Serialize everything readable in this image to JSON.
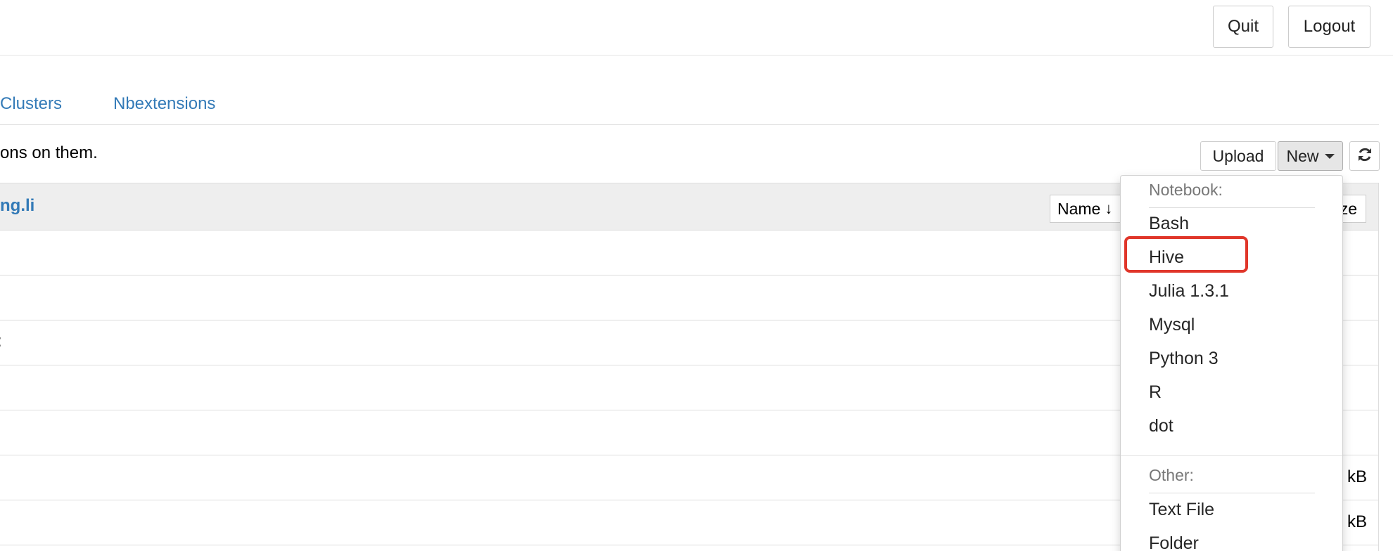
{
  "header": {
    "quit_label": "Quit",
    "logout_label": "Logout"
  },
  "tabs": [
    {
      "label": "Clusters"
    },
    {
      "label": "Nbextensions"
    }
  ],
  "toolbar": {
    "intro_text": "ons on them.",
    "upload_label": "Upload",
    "new_label": "New"
  },
  "list": {
    "breadcrumb": "ng.li",
    "sort_name_label": "Name",
    "sort_size_label": "ze",
    "rows": [
      {
        "prefix": "",
        "size": ""
      },
      {
        "prefix": "",
        "size": ""
      },
      {
        "prefix": ":",
        "size": ""
      },
      {
        "prefix": "",
        "size": ""
      },
      {
        "prefix": "",
        "size": ""
      },
      {
        "prefix": "",
        "size": "kB"
      },
      {
        "prefix": "",
        "size": "kB"
      }
    ]
  },
  "dropdown": {
    "notebook_header": "Notebook:",
    "notebook_items": [
      "Bash",
      "Hive",
      "Julia 1.3.1",
      "Mysql",
      "Python 3",
      "R",
      "dot"
    ],
    "other_header": "Other:",
    "other_items": [
      "Text File",
      "Folder"
    ]
  },
  "colors": {
    "link": "#337ab7",
    "highlight": "#e0362a"
  },
  "icons": {
    "refresh": "refresh-icon",
    "sort": "arrow-down-icon",
    "caret": "caret-down-icon"
  }
}
